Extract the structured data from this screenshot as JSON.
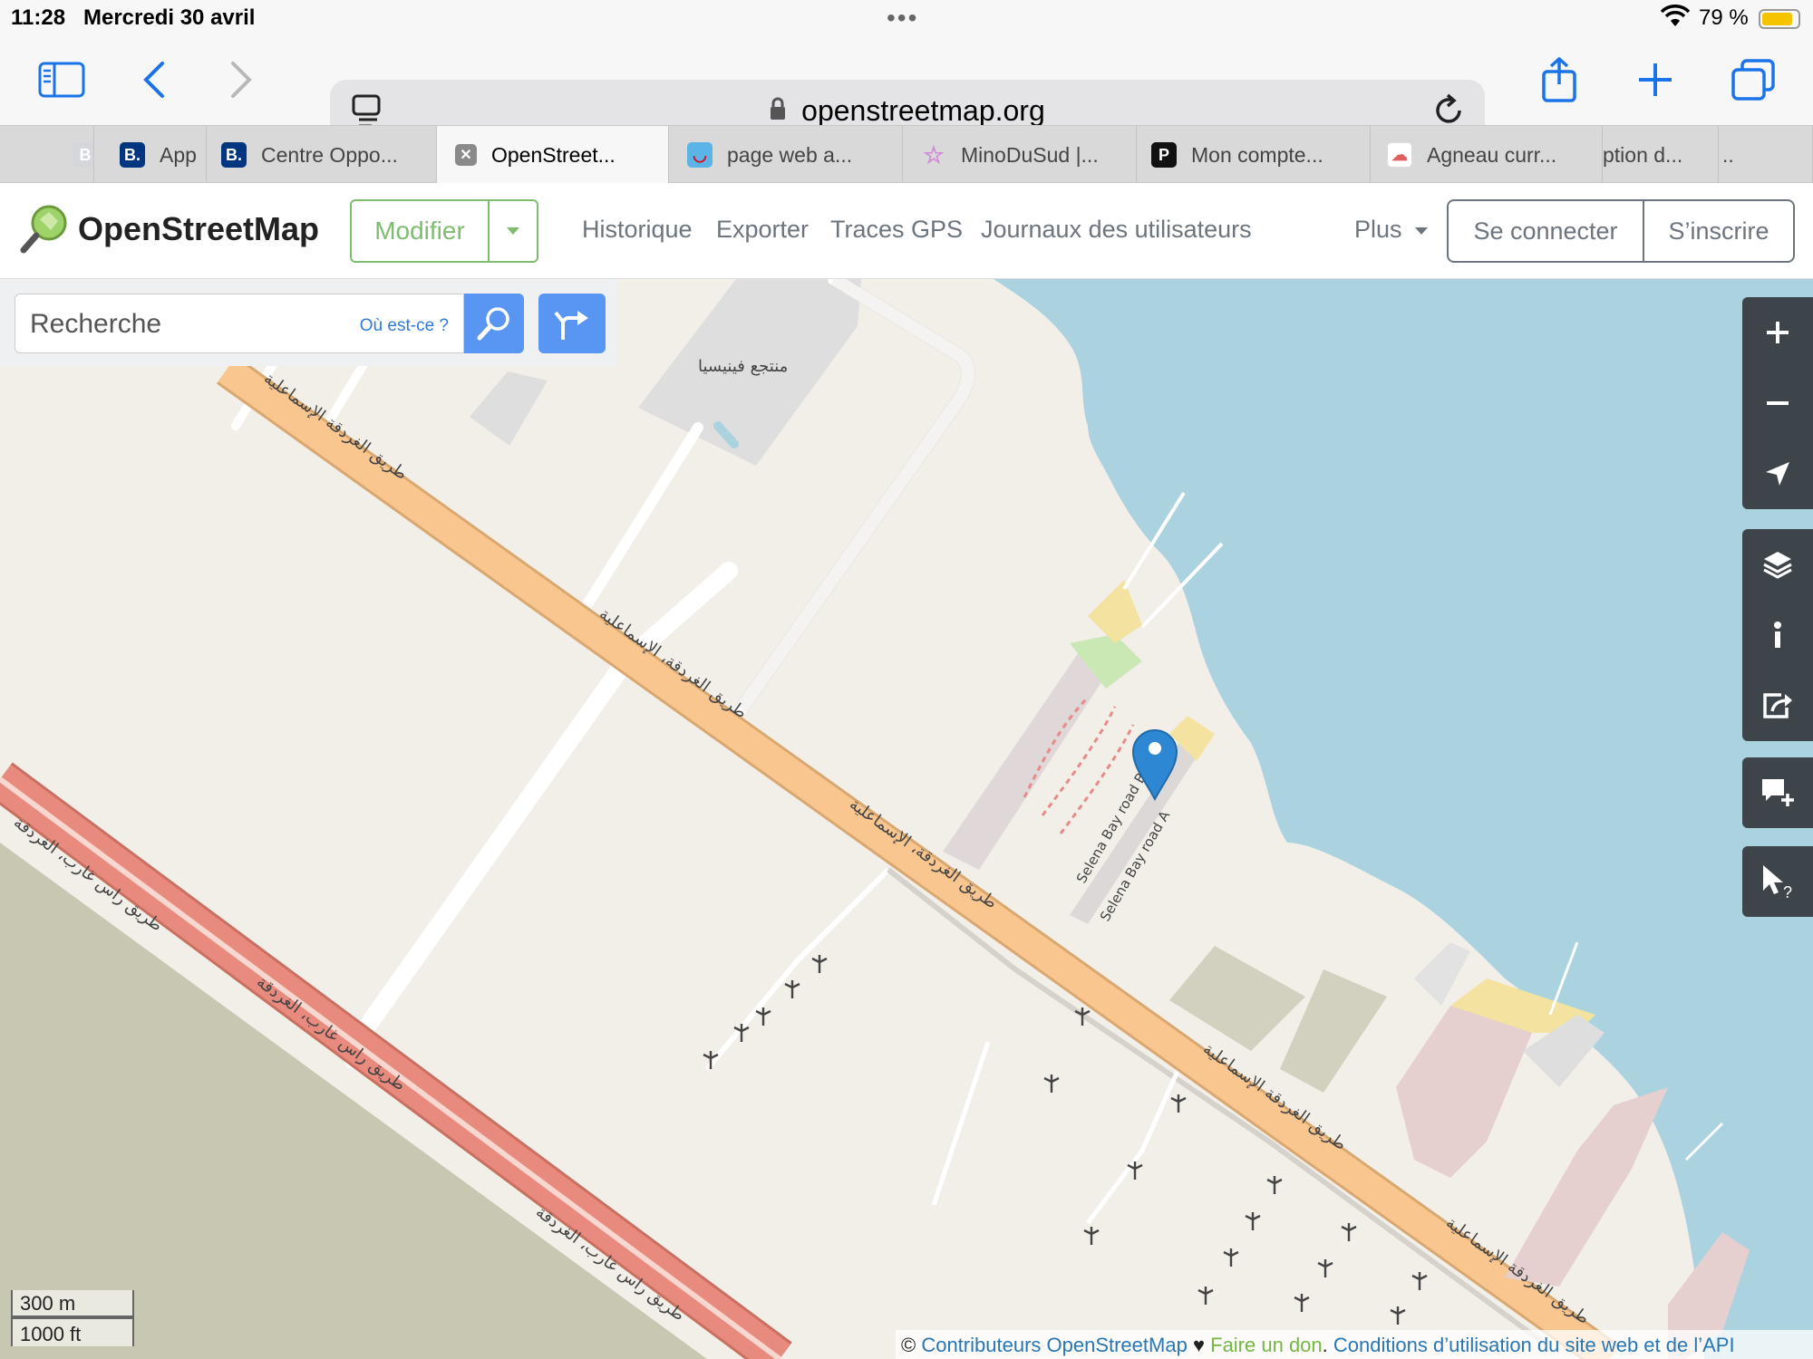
{
  "status_bar": {
    "time": "11:28",
    "date": "Mercredi 30 avril",
    "battery": "79 %",
    "battery_level": 0.79,
    "battery_color": "#f5c400"
  },
  "browser": {
    "url": "openstreetmap.org",
    "icons": [
      "sidebar-icon",
      "back-icon",
      "forward-icon",
      "reader-icon",
      "lock-icon",
      "reload-icon",
      "share-icon",
      "new-tab-icon",
      "tabs-overview-icon"
    ],
    "tabs": [
      {
        "label": "",
        "favicon": "B"
      },
      {
        "label": "App",
        "favicon": "B."
      },
      {
        "label": "Centre Oppo...",
        "favicon": "B."
      },
      {
        "label": "OpenStreet...",
        "favicon": "close"
      },
      {
        "label": "page web a...",
        "favicon": "tui"
      },
      {
        "label": "MinoDuSud |...",
        "favicon": "star"
      },
      {
        "label": "Mon compte...",
        "favicon": "P"
      },
      {
        "label": "Agneau curr...",
        "favicon": "cook"
      },
      {
        "label": "ption d...",
        "favicon": ""
      },
      {
        "label": "..",
        "favicon": ""
      }
    ]
  },
  "osm": {
    "title": "OpenStreetMap",
    "edit_label": "Modifier",
    "nav": [
      "Historique",
      "Exporter",
      "Traces GPS",
      "Journaux des utilisateurs"
    ],
    "more_label": "Plus",
    "login_label": "Se connecter",
    "signup_label": "S’inscrire",
    "accent": "#7ebc6f",
    "search": {
      "placeholder": "Recherche",
      "where_label": "Où est-ce ?"
    }
  },
  "map": {
    "labels": {
      "road_main": "طريق الغردقة الإسماعلية",
      "road_main_mid": "طريق الغردقة، الإسماعلية",
      "road_coast": "طريق راس غارب، الغردقة",
      "place": "منتجع فينيسيا",
      "selena_a": "Selena Bay road A",
      "selena_b": "Selena Bay road B"
    },
    "controls": [
      "zoom-in-icon",
      "zoom-out-icon",
      "locate-icon",
      "layers-icon",
      "info-icon",
      "share-icon",
      "add-note-icon",
      "query-icon"
    ],
    "scale_metric": "300 m",
    "scale_imperial": "1000 ft",
    "attribution": {
      "copyright": "© ",
      "contributors": "Contributeurs OpenStreetMap",
      "heart": " ♥ ",
      "donate": "Faire un don",
      "sep": ". ",
      "terms": "Conditions d’utilisation du site web et de l’API"
    },
    "colors": {
      "water": "#aad3df",
      "land": "#f2efe9",
      "trunk": "#f9c690",
      "primary_red": "#e88a7d",
      "desert": "#c8c8b2",
      "marker": "#2d87d2"
    }
  }
}
